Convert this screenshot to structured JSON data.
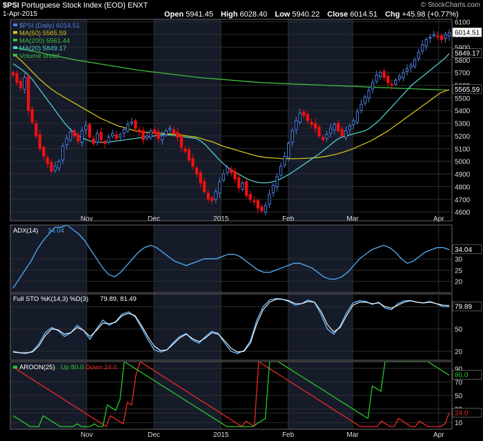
{
  "header": {
    "symbol": "$PSI",
    "name": "Portuguese Stock Index (EOD)",
    "exchange": "ENXT",
    "date": "1-Apr-2015",
    "brand": "© StockCharts.com",
    "open_label": "Open",
    "open": "5941.45",
    "high_label": "High",
    "high": "6028.40",
    "low_label": "Low",
    "low": "5940.22",
    "close_label": "Close",
    "close": "6014.51",
    "chg_label": "Chg",
    "chg": "+45.98 (+0.77%)"
  },
  "colors": {
    "up_candle": "#4f7fe0",
    "down_candle": "#ee1111",
    "ma50": "#d4c21a",
    "ma200": "#3fbf3f",
    "ma20": "#4fd0d0",
    "adx": "#4ea6ea",
    "sto_k": "#60b8ff",
    "sto_d": "#ffffff",
    "aroon_up": "#28c828",
    "aroon_down": "#ee2828",
    "grid": "#2e2e2e",
    "band": "#161b2a"
  },
  "chart_data": [
    {
      "type": "candlestick",
      "title": "$PSI (Daily) 6014.51",
      "legend": [
        {
          "name": "$PSI (Daily)",
          "value": "6014.51",
          "color": "#4f7fe0"
        },
        {
          "name": "MA(50)",
          "value": "5565.59",
          "color": "#d4c21a"
        },
        {
          "name": "MA(200)",
          "value": "5561.44",
          "color": "#3fbf3f"
        },
        {
          "name": "MA(20)",
          "value": "5849.17",
          "color": "#4fd0d0"
        },
        {
          "name": "Volume undef",
          "value": "",
          "color": "#3fbf3f"
        }
      ],
      "ylim": [
        4530,
        6120
      ],
      "y_ticks": [
        4600,
        4700,
        4800,
        4900,
        5000,
        5100,
        5200,
        5300,
        5400,
        5500,
        5600,
        5700,
        5800,
        5900,
        6000,
        6100
      ],
      "x_ticks": [
        {
          "label": "Nov",
          "x": 0.173
        },
        {
          "label": "Dec",
          "x": 0.325
        },
        {
          "label": "2015",
          "x": 0.477
        },
        {
          "label": "Feb",
          "x": 0.629
        },
        {
          "label": "Mar",
          "x": 0.775
        },
        {
          "label": "Apr",
          "x": 0.97
        }
      ],
      "right_labels": [
        {
          "text": "6014.51",
          "value": 6014.51,
          "highlight": true
        },
        {
          "text": "5849.17",
          "value": 5849.17
        },
        {
          "text": "5565.59",
          "value": 5565.59
        }
      ],
      "close": [
        5680,
        5620,
        5580,
        5660,
        5400,
        5310,
        5200,
        5100,
        5040,
        4980,
        4920,
        4960,
        5000,
        5120,
        5180,
        5230,
        5200,
        5160,
        5240,
        5280,
        5190,
        5140,
        5220,
        5170,
        5140,
        5190,
        5220,
        5180,
        5210,
        5250,
        5290,
        5310,
        5260,
        5230,
        5170,
        5200,
        5240,
        5220,
        5180,
        5200,
        5240,
        5260,
        5220,
        5190,
        5110,
        5080,
        5010,
        4960,
        4900,
        4830,
        4760,
        4700,
        4690,
        4760,
        4840,
        4900,
        4950,
        4910,
        4860,
        4790,
        4830,
        4730,
        4700,
        4680,
        4630,
        4610,
        4650,
        4740,
        4810,
        4880,
        4960,
        5040,
        5140,
        5240,
        5320,
        5380,
        5360,
        5320,
        5290,
        5260,
        5200,
        5170,
        5210,
        5260,
        5290,
        5240,
        5200,
        5240,
        5280,
        5320,
        5390,
        5450,
        5510,
        5560,
        5620,
        5680,
        5700,
        5660,
        5620,
        5600,
        5640,
        5670,
        5700,
        5730,
        5760,
        5800,
        5860,
        5920,
        5960,
        5980,
        6000,
        5980,
        5960,
        6000,
        6014.51
      ],
      "ma20": [
        5770,
        5745,
        5720,
        5690,
        5650,
        5600,
        5550,
        5500,
        5450,
        5400,
        5350,
        5300,
        5260,
        5225,
        5200,
        5180,
        5165,
        5155,
        5150,
        5150,
        5152,
        5155,
        5160,
        5165,
        5170,
        5175,
        5180,
        5185,
        5190,
        5195,
        5200,
        5205,
        5210,
        5208,
        5205,
        5200,
        5195,
        5190,
        5185,
        5180,
        5160,
        5130,
        5090,
        5050,
        5010,
        4975,
        4945,
        4920,
        4900,
        4880,
        4860,
        4845,
        4835,
        4830,
        4830,
        4835,
        4845,
        4860,
        4880,
        4900,
        4925,
        4950,
        4975,
        5000,
        5025,
        5050,
        5080,
        5110,
        5140,
        5170,
        5190,
        5200,
        5210,
        5220,
        5230,
        5240,
        5260,
        5290,
        5320,
        5360,
        5400,
        5440,
        5480,
        5520,
        5560,
        5600,
        5630,
        5660,
        5690,
        5720,
        5750,
        5780,
        5810,
        5849.17
      ],
      "ma50": [
        5850,
        5790,
        5720,
        5650,
        5590,
        5540,
        5500,
        5460,
        5420,
        5380,
        5340,
        5310,
        5280,
        5260,
        5240,
        5230,
        5225,
        5220,
        5215,
        5210,
        5200,
        5190,
        5170,
        5150,
        5120,
        5100,
        5080,
        5060,
        5040,
        5030,
        5025,
        5020,
        5020,
        5022,
        5025,
        5030,
        5040,
        5055,
        5075,
        5100,
        5130,
        5160,
        5200,
        5240,
        5290,
        5340,
        5390,
        5440,
        5490,
        5540,
        5565.59
      ],
      "ma200": [
        5900,
        5850,
        5800,
        5760,
        5720,
        5690,
        5660,
        5640,
        5620,
        5610,
        5600,
        5590,
        5580,
        5570,
        5561.44
      ]
    },
    {
      "type": "line",
      "title": "ADX(14)",
      "value": "34.04",
      "ylim": [
        15,
        45
      ],
      "y_ticks": [
        20,
        25,
        30
      ],
      "right_label": "34.04",
      "values": [
        17,
        21,
        25,
        29,
        34,
        38,
        41,
        44,
        44,
        45,
        43,
        41,
        38,
        34,
        30,
        26,
        23,
        22,
        24,
        27,
        30,
        33,
        35,
        36,
        35,
        33,
        31,
        29,
        28,
        27,
        28,
        29,
        30,
        30,
        30,
        31,
        32,
        32,
        31,
        29,
        27,
        25,
        24,
        24,
        25,
        26,
        27,
        28,
        28,
        27,
        26,
        24,
        22,
        21,
        21,
        22,
        24,
        27,
        30,
        32,
        34,
        35,
        36,
        35,
        33,
        30,
        28,
        29,
        31,
        33,
        34,
        35,
        35,
        34.04
      ]
    },
    {
      "type": "line",
      "title": "Full STO %K(14,3) %D(3)",
      "value": "79.89, 81.49",
      "ylim": [
        8,
        97
      ],
      "y_ticks": [
        20,
        50,
        80
      ],
      "right_label": "79.89",
      "series": [
        {
          "name": "%K",
          "values": [
            20,
            18,
            17,
            20,
            30,
            45,
            52,
            48,
            40,
            45,
            55,
            48,
            36,
            50,
            62,
            55,
            60,
            70,
            73,
            67,
            52,
            36,
            22,
            19,
            22,
            32,
            40,
            44,
            35,
            31,
            40,
            47,
            44,
            31,
            20,
            17,
            21,
            34,
            62,
            80,
            89,
            91,
            90,
            87,
            82,
            84,
            89,
            86,
            70,
            50,
            43,
            54,
            72,
            85,
            88,
            87,
            83,
            86,
            78,
            76,
            84,
            88,
            88,
            86,
            85,
            87,
            84,
            80,
            79.89
          ]
        },
        {
          "name": "%D",
          "values": [
            19,
            18,
            18,
            19,
            27,
            41,
            50,
            49,
            43,
            45,
            52,
            48,
            40,
            48,
            58,
            57,
            59,
            68,
            71,
            68,
            55,
            40,
            27,
            21,
            22,
            30,
            38,
            43,
            37,
            33,
            38,
            45,
            43,
            34,
            24,
            19,
            20,
            31,
            57,
            76,
            86,
            90,
            90,
            88,
            84,
            84,
            87,
            86,
            74,
            56,
            46,
            52,
            68,
            82,
            86,
            86,
            84,
            85,
            80,
            78,
            82,
            86,
            88,
            86,
            85,
            86,
            84,
            82,
            81.49
          ]
        }
      ]
    },
    {
      "type": "line",
      "title": "AROON(25)",
      "value": "Up 80.0 Down 24.0",
      "ylim": [
        0,
        100
      ],
      "y_ticks": [
        10,
        24,
        30,
        50,
        70,
        90
      ],
      "right_labels": [
        {
          "text": "80.0",
          "value": 80
        },
        {
          "text": "24.0",
          "value": 24
        }
      ],
      "series": [
        {
          "name": "Up 80.0",
          "values": [
            20,
            16,
            12,
            8,
            4,
            4,
            4,
            20,
            16,
            12,
            8,
            4,
            4,
            4,
            4,
            8,
            4,
            4,
            4,
            8,
            4,
            4,
            36,
            32,
            28,
            44,
            100,
            96,
            92,
            88,
            84,
            80,
            76,
            72,
            68,
            64,
            60,
            56,
            52,
            48,
            44,
            40,
            36,
            32,
            28,
            24,
            20,
            16,
            12,
            8,
            4,
            4,
            4,
            4,
            4,
            4,
            4,
            8,
            12,
            16,
            100,
            100,
            100,
            96,
            92,
            88,
            84,
            80,
            76,
            72,
            68,
            64,
            60,
            56,
            52,
            48,
            44,
            40,
            36,
            32,
            28,
            24,
            20,
            16,
            64,
            60,
            56,
            100,
            100,
            100,
            100,
            100,
            100,
            100,
            100,
            100,
            100,
            100,
            96,
            92,
            88,
            84,
            80
          ]
        },
        {
          "name": "Down 24.0",
          "values": [
            92,
            88,
            84,
            80,
            76,
            72,
            68,
            64,
            60,
            56,
            52,
            48,
            44,
            40,
            36,
            32,
            28,
            24,
            20,
            16,
            12,
            8,
            4,
            20,
            16,
            12,
            8,
            40,
            36,
            80,
            100,
            96,
            92,
            88,
            84,
            80,
            76,
            72,
            68,
            64,
            60,
            56,
            52,
            48,
            44,
            40,
            36,
            32,
            28,
            24,
            20,
            16,
            12,
            8,
            4,
            12,
            8,
            4,
            100,
            96,
            92,
            88,
            84,
            80,
            76,
            72,
            68,
            64,
            60,
            56,
            52,
            48,
            44,
            40,
            36,
            32,
            28,
            24,
            20,
            16,
            12,
            8,
            4,
            4,
            4,
            4,
            4,
            12,
            8,
            4,
            4,
            16,
            12,
            8,
            4,
            4,
            12,
            8,
            4,
            4,
            4,
            4,
            8,
            24
          ]
        }
      ]
    }
  ]
}
